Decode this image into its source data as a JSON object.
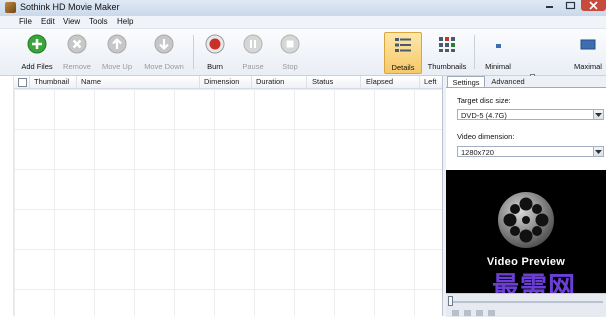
{
  "window": {
    "title": "Sothink HD Movie Maker"
  },
  "menu": [
    "File",
    "Edit",
    "View",
    "Tools",
    "Help"
  ],
  "toolbar": {
    "add_files": "Add Files",
    "remove": "Remove",
    "move_up": "Move Up",
    "move_down": "Move Down",
    "burn": "Burn",
    "pause": "Pause",
    "stop": "Stop",
    "details": "Details",
    "thumbnails": "Thumbnails",
    "minimal": "Minimal",
    "maximal": "Maximal"
  },
  "list": {
    "columns": [
      "Thumbnail",
      "Name",
      "Dimension",
      "Duration",
      "Status",
      "Elapsed",
      "Left"
    ]
  },
  "panel": {
    "tabs": [
      "Settings",
      "Advanced"
    ],
    "target_disc_label": "Target disc size:",
    "target_disc_value": "DVD-5 (4.7G)",
    "video_dimension_label": "Video dimension:",
    "video_dimension_value": "1280x720"
  },
  "preview": {
    "text": "Video Preview",
    "watermark": "最需网"
  },
  "colors": {
    "add": "#3aa53a",
    "burn": "#c8302a",
    "disabled": "#b4b4b4",
    "active_tab": "#f6c86a"
  }
}
